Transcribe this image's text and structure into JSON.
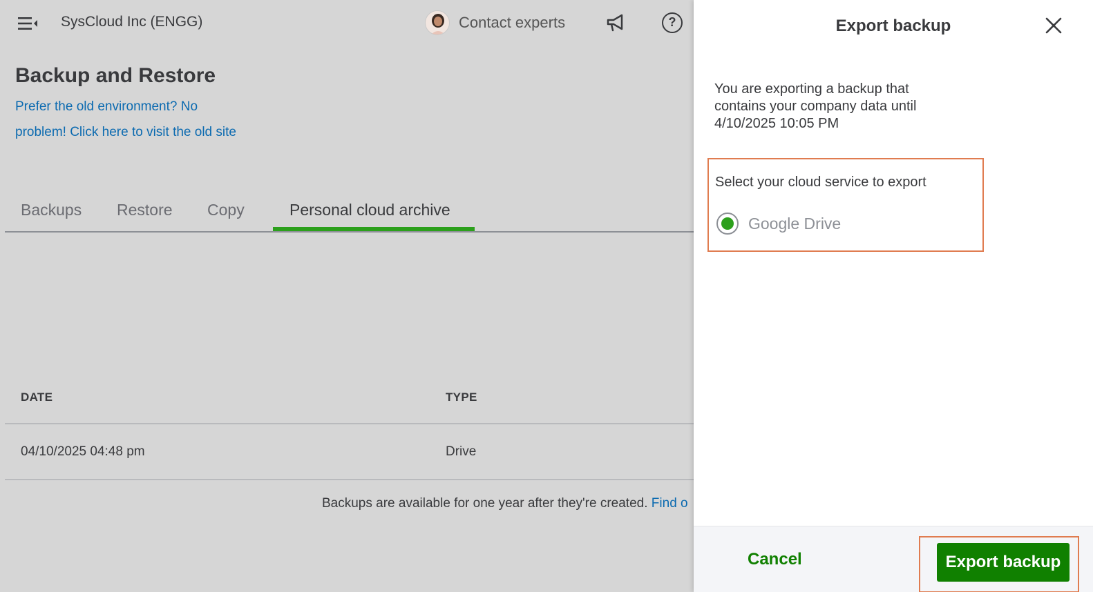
{
  "header": {
    "company_name": "SysCloud Inc (ENGG)",
    "contact_label": "Contact experts",
    "help_symbol": "?"
  },
  "page": {
    "title": "Backup and Restore",
    "old_site_link": "Prefer the old environment? No problem! Click here to visit the old site"
  },
  "tabs": [
    {
      "label": "Backups",
      "active": false
    },
    {
      "label": "Restore",
      "active": false
    },
    {
      "label": "Copy",
      "active": false
    },
    {
      "label": "Personal cloud archive",
      "active": true
    }
  ],
  "table": {
    "columns": [
      "DATE",
      "TYPE"
    ],
    "rows": [
      {
        "date": "04/10/2025 04:48 pm",
        "type": "Drive"
      }
    ]
  },
  "footnote": {
    "text": "Backups are available for one year after they're created.",
    "link": "Find o"
  },
  "drawer": {
    "title": "Export backup",
    "description": "You are exporting a backup that contains your company data until 4/10/2025 10:05 PM",
    "select_label": "Select your cloud service to export",
    "option_label": "Google Drive",
    "option_selected": true,
    "cancel_label": "Cancel",
    "export_label": "Export backup"
  },
  "colors": {
    "accent_green": "#2ca01c",
    "button_green": "#108000",
    "link_blue": "#0b6ab0",
    "highlight_orange": "#e07c50"
  }
}
